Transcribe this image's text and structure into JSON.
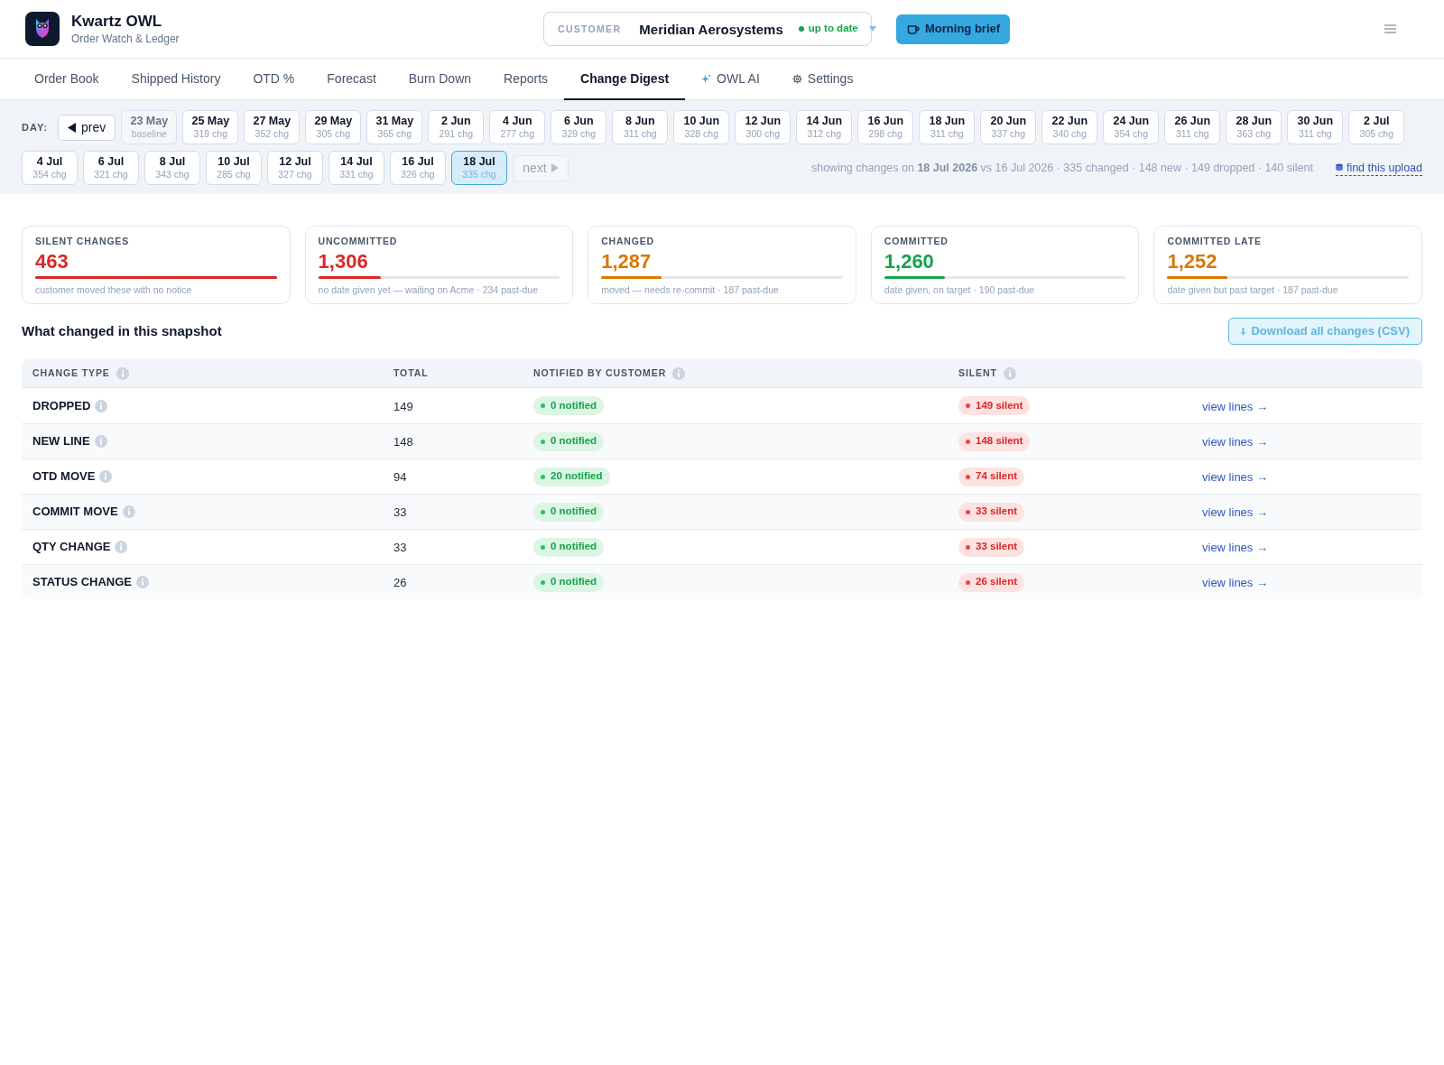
{
  "app": {
    "title": "Kwartz OWL",
    "subtitle": "Order Watch & Ledger"
  },
  "customer": {
    "label": "CUSTOMER",
    "name": "Meridian Aerosystems",
    "status": "up to date"
  },
  "brief_button": {
    "label": "Morning brief"
  },
  "tabs": [
    {
      "label": "Order Book",
      "selected": false,
      "kind": "plain"
    },
    {
      "label": "Shipped History",
      "selected": false,
      "kind": "plain"
    },
    {
      "label": "OTD %",
      "selected": false,
      "kind": "plain"
    },
    {
      "label": "Forecast",
      "selected": false,
      "kind": "plain"
    },
    {
      "label": "Burn Down",
      "selected": false,
      "kind": "plain"
    },
    {
      "label": "Reports",
      "selected": false,
      "kind": "plain"
    },
    {
      "label": "Change Digest",
      "selected": true,
      "kind": "plain"
    },
    {
      "label": "OWL AI",
      "selected": false,
      "kind": "ai"
    },
    {
      "label": "Settings",
      "selected": false,
      "kind": "settings"
    }
  ],
  "day_bar": {
    "label": "DAY:",
    "prev": {
      "label": "prev",
      "disabled": false
    },
    "days": [
      {
        "date": "23 May",
        "note": "baseline",
        "selected": false,
        "disabled": true
      },
      {
        "date": "25 May",
        "note": "319 chg",
        "selected": false,
        "disabled": false
      },
      {
        "date": "27 May",
        "note": "352 chg",
        "selected": false,
        "disabled": false
      },
      {
        "date": "29 May",
        "note": "305 chg",
        "selected": false,
        "disabled": false
      },
      {
        "date": "31 May",
        "note": "365 chg",
        "selected": false,
        "disabled": false
      },
      {
        "date": "2 Jun",
        "note": "291 chg",
        "selected": false,
        "disabled": false
      },
      {
        "date": "4 Jun",
        "note": "277 chg",
        "selected": false,
        "disabled": false
      },
      {
        "date": "6 Jun",
        "note": "329 chg",
        "selected": false,
        "disabled": false
      },
      {
        "date": "8 Jun",
        "note": "311 chg",
        "selected": false,
        "disabled": false
      },
      {
        "date": "10 Jun",
        "note": "328 chg",
        "selected": false,
        "disabled": false
      },
      {
        "date": "12 Jun",
        "note": "300 chg",
        "selected": false,
        "disabled": false
      },
      {
        "date": "14 Jun",
        "note": "312 chg",
        "selected": false,
        "disabled": false
      },
      {
        "date": "16 Jun",
        "note": "298 chg",
        "selected": false,
        "disabled": false
      },
      {
        "date": "18 Jun",
        "note": "311 chg",
        "selected": false,
        "disabled": false
      },
      {
        "date": "20 Jun",
        "note": "337 chg",
        "selected": false,
        "disabled": false
      },
      {
        "date": "22 Jun",
        "note": "340 chg",
        "selected": false,
        "disabled": false
      },
      {
        "date": "24 Jun",
        "note": "354 chg",
        "selected": false,
        "disabled": false
      },
      {
        "date": "26 Jun",
        "note": "311 chg",
        "selected": false,
        "disabled": false
      },
      {
        "date": "28 Jun",
        "note": "363 chg",
        "selected": false,
        "disabled": false
      },
      {
        "date": "30 Jun",
        "note": "311 chg",
        "selected": false,
        "disabled": false
      },
      {
        "date": "2 Jul",
        "note": "305 chg",
        "selected": false,
        "disabled": false
      },
      {
        "date": "4 Jul",
        "note": "354 chg",
        "selected": false,
        "disabled": false
      },
      {
        "date": "6 Jul",
        "note": "321 chg",
        "selected": false,
        "disabled": false
      },
      {
        "date": "8 Jul",
        "note": "343 chg",
        "selected": false,
        "disabled": false
      },
      {
        "date": "10 Jul",
        "note": "285 chg",
        "selected": false,
        "disabled": false
      },
      {
        "date": "12 Jul",
        "note": "327 chg",
        "selected": false,
        "disabled": false
      },
      {
        "date": "14 Jul",
        "note": "331 chg",
        "selected": false,
        "disabled": false
      },
      {
        "date": "16 Jul",
        "note": "326 chg",
        "selected": false,
        "disabled": false
      },
      {
        "date": "18 Jul",
        "note": "335 chg",
        "selected": true,
        "disabled": false
      }
    ],
    "next": {
      "label": "next",
      "disabled": true
    },
    "summary": "showing changes on **18 Jul 2026** vs 16 Jul 2026 · 335 changed · 148 new · 149 dropped · 140 silent",
    "link": "find this upload"
  },
  "stats": [
    {
      "label": "SILENT CHANGES",
      "value": "463",
      "color": "#dc2626",
      "level": 1,
      "caption": "customer moved these with no notice"
    },
    {
      "label": "UNCOMMITTED",
      "value": "1,306",
      "color": "#dc2626",
      "level": 0.26,
      "caption": "no date given yet — waiting on Acme · 234 past-due"
    },
    {
      "label": "CHANGED",
      "value": "1,287",
      "color": "#d97706",
      "level": 0.25,
      "caption": "moved — needs re-commit · 187 past-due"
    },
    {
      "label": "COMMITTED",
      "value": "1,260",
      "color": "#16a34a",
      "level": 0.25,
      "caption": "date given, on target · 190 past-due"
    },
    {
      "label": "COMMITTED LATE",
      "value": "1,252",
      "color": "#d97706",
      "level": 0.25,
      "caption": "date given but past target · 187 past-due"
    }
  ],
  "section": {
    "title": "What changed in this snapshot",
    "download_button": "Download all changes (CSV)"
  },
  "table": {
    "columns": [
      {
        "label": "CHANGE TYPE",
        "info": true
      },
      {
        "label": "TOTAL",
        "info": false
      },
      {
        "label": "NOTIFIED BY CUSTOMER",
        "info": true
      },
      {
        "label": "SILENT",
        "info": true
      }
    ],
    "rows": [
      {
        "type": "DROPPED",
        "total": "149",
        "notified": "0 notified",
        "silent": "149 silent",
        "link": "view lines →"
      },
      {
        "type": "NEW LINE",
        "total": "148",
        "notified": "0 notified",
        "silent": "148 silent",
        "link": "view lines →"
      },
      {
        "type": "OTD MOVE",
        "total": "94",
        "notified": "20 notified",
        "silent": "74 silent",
        "link": "view lines →"
      },
      {
        "type": "COMMIT MOVE",
        "total": "33",
        "notified": "0 notified",
        "silent": "33 silent",
        "link": "view lines →"
      },
      {
        "type": "QTY CHANGE",
        "total": "33",
        "notified": "0 notified",
        "silent": "33 silent",
        "link": "view lines →"
      },
      {
        "type": "STATUS CHANGE",
        "total": "26",
        "notified": "0 notified",
        "silent": "26 silent",
        "link": "view lines →"
      }
    ]
  }
}
